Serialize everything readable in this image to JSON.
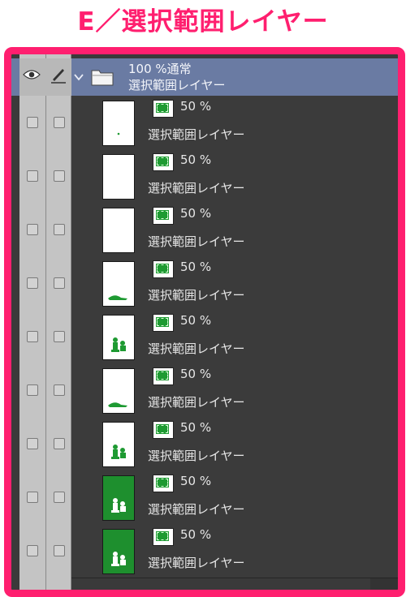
{
  "heading": "E／選択範囲レイヤー",
  "colors": {
    "accent": "#ff1f6f",
    "folder_bg": "#6a7ba3",
    "panel_bg": "#3a3a3a",
    "mask_green": "#1e9a32"
  },
  "folder": {
    "line1": "100 %通常",
    "line2": "選択範囲レイヤー",
    "icons": [
      "eye-icon",
      "pen-icon",
      "chevron-down-icon",
      "folder-icon"
    ]
  },
  "layers": [
    {
      "opacity": "50 %",
      "name": "選択範囲レイヤー",
      "thumb": "dot"
    },
    {
      "opacity": "50 %",
      "name": "選択範囲レイヤー",
      "thumb": "blank"
    },
    {
      "opacity": "50 %",
      "name": "選択範囲レイヤー",
      "thumb": "blank"
    },
    {
      "opacity": "50 %",
      "name": "選択範囲レイヤー",
      "thumb": "stroke"
    },
    {
      "opacity": "50 %",
      "name": "選択範囲レイヤー",
      "thumb": "figure"
    },
    {
      "opacity": "50 %",
      "name": "選択範囲レイヤー",
      "thumb": "stroke"
    },
    {
      "opacity": "50 %",
      "name": "選択範囲レイヤー",
      "thumb": "figure"
    },
    {
      "opacity": "50 %",
      "name": "選択範囲レイヤー",
      "thumb": "figure-dark"
    },
    {
      "opacity": "50 %",
      "name": "選択範囲レイヤー",
      "thumb": "figure-dark"
    }
  ]
}
